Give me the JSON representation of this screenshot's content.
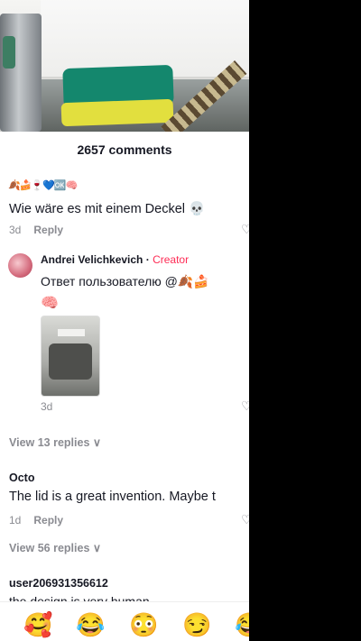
{
  "header": {
    "comment_count": "2657 comments"
  },
  "labels": {
    "reply": "Reply"
  },
  "comments": [
    {
      "author": "🍂🍰🍷💙🆗🧠",
      "text": "Wie wäre es mit einem Deckel 💀",
      "date": "3d",
      "view_replies": "View 13 replies ∨"
    },
    {
      "author": "Octo",
      "text": "The lid is a great invention. Maybe t",
      "date": "1d",
      "view_replies": "View 56 replies ∨"
    },
    {
      "author": "user206931356612",
      "text": "the design is very human"
    }
  ],
  "creator_reply": {
    "author": "Andrei Velichkevich",
    "badge": "Creator",
    "text": "Ответ пользователю @🍂🍰",
    "emoji": "🧠",
    "date": "3d"
  },
  "emoji_bar": [
    "🥰",
    "😂",
    "😳",
    "😏",
    "😂"
  ]
}
